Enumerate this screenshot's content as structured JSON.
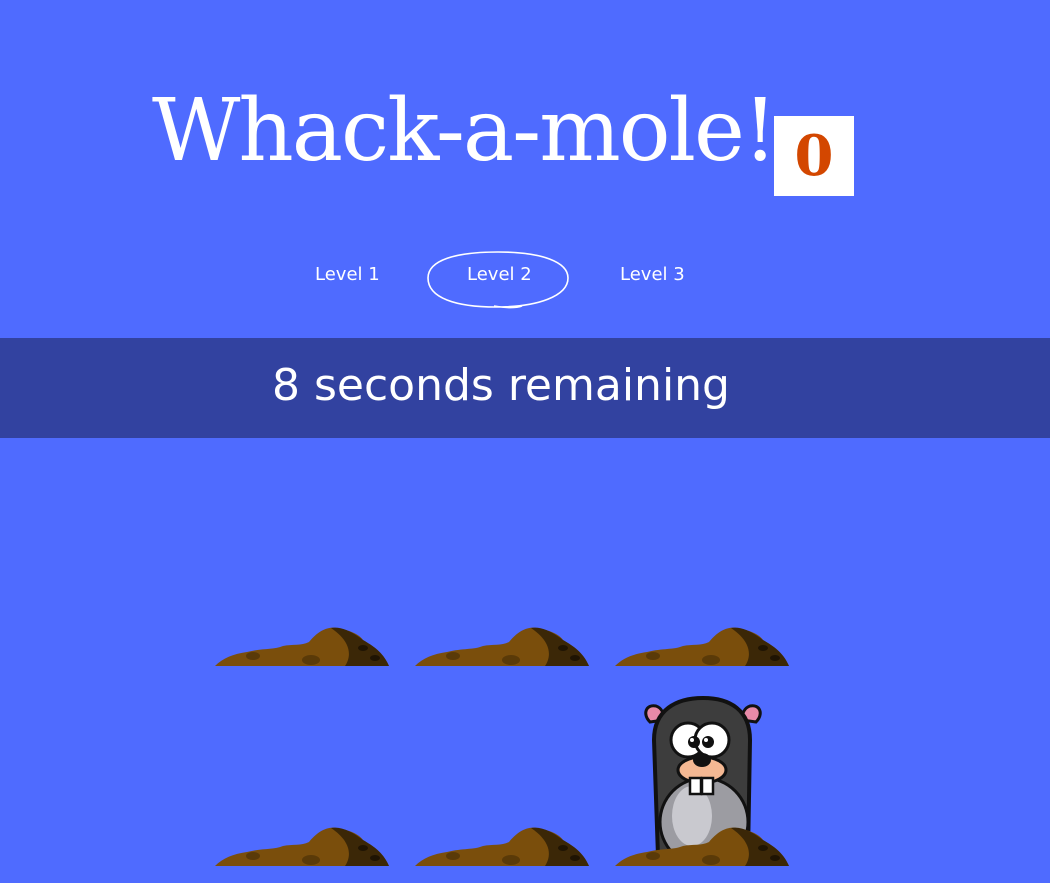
{
  "header": {
    "title": "Whack-a-mole!",
    "score": "0"
  },
  "levels": {
    "items": [
      "Level 1",
      "Level 2",
      "Level 3"
    ],
    "selected": "Level 2"
  },
  "timer": {
    "text": "8 seconds remaining"
  },
  "board": {
    "rows": 2,
    "columns": 3,
    "mole_position": {
      "row": 2,
      "column": 3
    }
  },
  "colors": {
    "background": "#4f6bff",
    "timer_bar": "#3242a0",
    "score_text": "#d34700",
    "dirt": "#7a4e0c"
  },
  "icons": {
    "hole": "dirt-mound-icon",
    "mole": "mole-icon"
  }
}
